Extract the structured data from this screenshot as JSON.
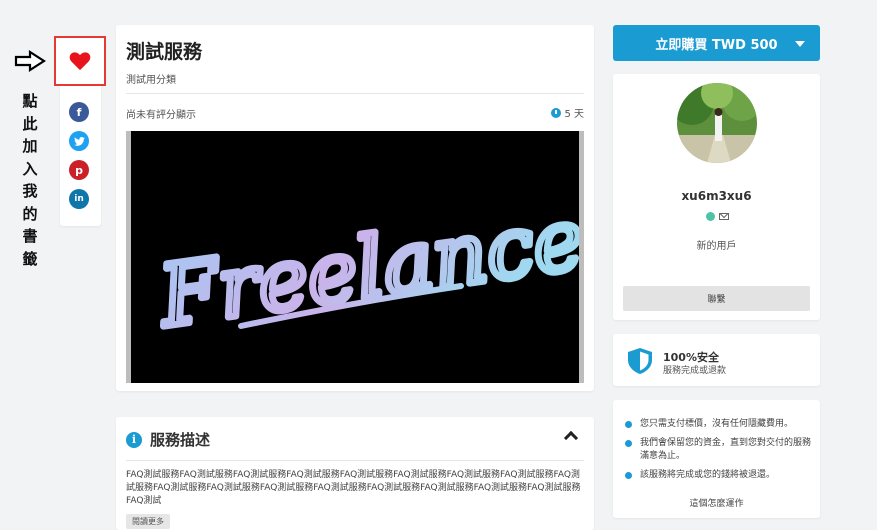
{
  "annotation": {
    "chars": [
      "點",
      "此",
      "加",
      "入",
      "我",
      "的",
      "書",
      "籤"
    ]
  },
  "share": {
    "favorite_icon": "heart-icon",
    "networks": [
      {
        "name": "facebook-icon",
        "glyph": "f",
        "color": "#3b5998"
      },
      {
        "name": "twitter-icon",
        "glyph": "t",
        "color": "#1da1f2"
      },
      {
        "name": "pinterest-icon",
        "glyph": "p",
        "color": "#cb2027"
      },
      {
        "name": "linkedin-icon",
        "glyph": "in",
        "color": "#0e76a8"
      }
    ]
  },
  "service": {
    "title": "測試服務",
    "category": "測試用分類",
    "rating_text": "尚未有評分顯示",
    "delivery": "5 天",
    "image_text": "Freelance"
  },
  "description": {
    "title": "服務描述",
    "body": "FAQ測試服務FAQ測試服務FAQ測試服務FAQ測試服務FAQ測試服務FAQ測試服務FAQ測試服務FAQ測試服務FAQ測試服務FAQ測試服務FAQ測試服務FAQ測試服務FAQ測試服務FAQ測試服務FAQ測試服務FAQ測試服務FAQ測試服務FAQ測試",
    "read_more": "閱讀更多"
  },
  "purchase": {
    "label": "立即購買 TWD 500"
  },
  "seller": {
    "username": "xu6m3xu6",
    "status": "新的用戶",
    "contact_label": "聯繫"
  },
  "security": {
    "title": "100%安全",
    "subtitle": "服務完成或退款"
  },
  "guarantees": {
    "items": [
      "您只需支付標價，沒有任何隱藏費用。",
      "我們會保留您的資金，直到您對交付的服務滿意為止。",
      "該服務將完成或您的錢將被退還。"
    ],
    "how_link": "這個怎麼運作"
  },
  "colors": {
    "accent": "#1a9bd1",
    "favorite_red": "#e53935",
    "online": "#4cc3a8"
  }
}
